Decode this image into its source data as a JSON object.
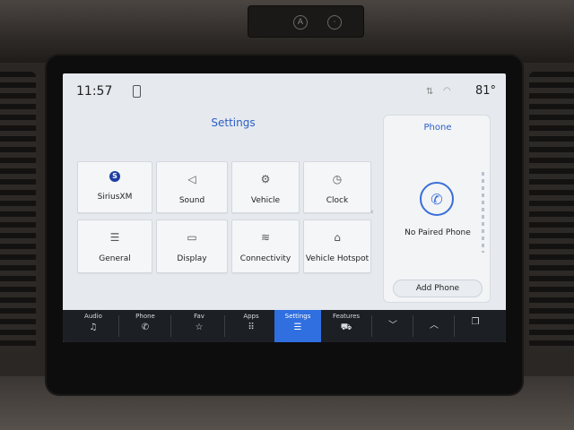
{
  "status_bar": {
    "time": "11:57",
    "temperature": "81°"
  },
  "settings": {
    "title": "Settings",
    "tiles": [
      {
        "label": "SiriusXM",
        "icon": "siriusxm-logo-icon"
      },
      {
        "label": "Sound",
        "icon": "speaker-icon"
      },
      {
        "label": "Vehicle",
        "icon": "vehicle-settings-icon"
      },
      {
        "label": "Clock",
        "icon": "clock-icon"
      },
      {
        "label": "General",
        "icon": "sliders-icon"
      },
      {
        "label": "Display",
        "icon": "display-icon"
      },
      {
        "label": "Connectivity",
        "icon": "wifi-icon"
      },
      {
        "label": "Vehicle Hotspot",
        "icon": "hotspot-icon"
      }
    ],
    "sxm_glyph": "S"
  },
  "phone_panel": {
    "title": "Phone",
    "status": "No Paired Phone",
    "add_button": "Add Phone"
  },
  "nav": {
    "items": [
      {
        "label": "Audio",
        "icon": "music-note-icon"
      },
      {
        "label": "Phone",
        "icon": "phone-icon"
      },
      {
        "label": "Fav",
        "icon": "star-icon"
      },
      {
        "label": "Apps",
        "icon": "apps-grid-icon"
      },
      {
        "label": "Settings",
        "icon": "sliders-icon",
        "active": true
      },
      {
        "label": "Features",
        "icon": "car-features-icon"
      },
      {
        "label": "",
        "icon": "chevron-down-icon"
      },
      {
        "label": "",
        "icon": "chevron-up-icon"
      },
      {
        "label": "",
        "icon": "recent-cards-icon"
      }
    ]
  },
  "colors": {
    "accent": "#2f6fe0",
    "title_blue": "#2b5fc7",
    "screen_bg": "#e6e9ee",
    "nav_bg": "#1c1f24"
  }
}
